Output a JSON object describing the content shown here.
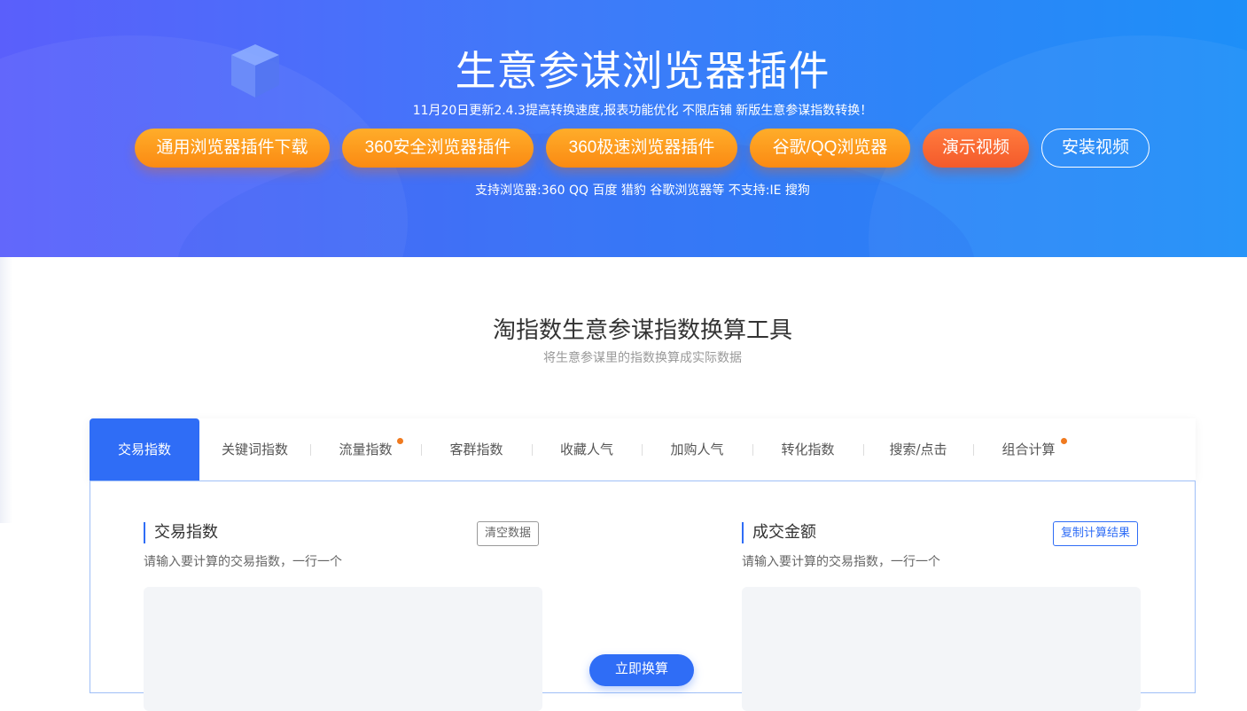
{
  "hero": {
    "title": "生意参谋浏览器插件",
    "subtitle": "11月20日更新2.4.3提高转换速度,报表功能优化 不限店铺 新版生意参谋指数转换！",
    "buttons": [
      {
        "label": "通用浏览器插件下载",
        "style": "orange"
      },
      {
        "label": "360安全浏览器插件",
        "style": "orange"
      },
      {
        "label": "360极速浏览器插件",
        "style": "orange"
      },
      {
        "label": "谷歌/QQ浏览器",
        "style": "orange"
      },
      {
        "label": "演示视频",
        "style": "red"
      },
      {
        "label": "安装视频",
        "style": "outline"
      }
    ],
    "support": "支持浏览器:360 QQ 百度 猎豹 谷歌浏览器等 不支持:IE 搜狗"
  },
  "section": {
    "title": "淘指数生意参谋指数换算工具",
    "subtitle": "将生意参谋里的指数换算成实际数据"
  },
  "tabs": [
    {
      "label": "交易指数",
      "active": true,
      "dot": false
    },
    {
      "label": "关键词指数",
      "active": false,
      "dot": false
    },
    {
      "label": "流量指数",
      "active": false,
      "dot": true
    },
    {
      "label": "客群指数",
      "active": false,
      "dot": false
    },
    {
      "label": "收藏人气",
      "active": false,
      "dot": false
    },
    {
      "label": "加购人气",
      "active": false,
      "dot": false
    },
    {
      "label": "转化指数",
      "active": false,
      "dot": false
    },
    {
      "label": "搜索/点击",
      "active": false,
      "dot": false
    },
    {
      "label": "组合计算",
      "active": false,
      "dot": true
    }
  ],
  "input_panel": {
    "title": "交易指数",
    "hint": "请输入要计算的交易指数，一行一个",
    "clear_label": "清空数据",
    "value": ""
  },
  "output_panel": {
    "title": "成交金额",
    "hint": "请输入要计算的交易指数，一行一个",
    "copy_label": "复制计算结果",
    "value": ""
  },
  "convert_label": "立即换算",
  "colors": {
    "accent": "#2f6df6",
    "orange": "#fb8a12",
    "red": "#f45a2b",
    "dot": "#f07a1f"
  }
}
